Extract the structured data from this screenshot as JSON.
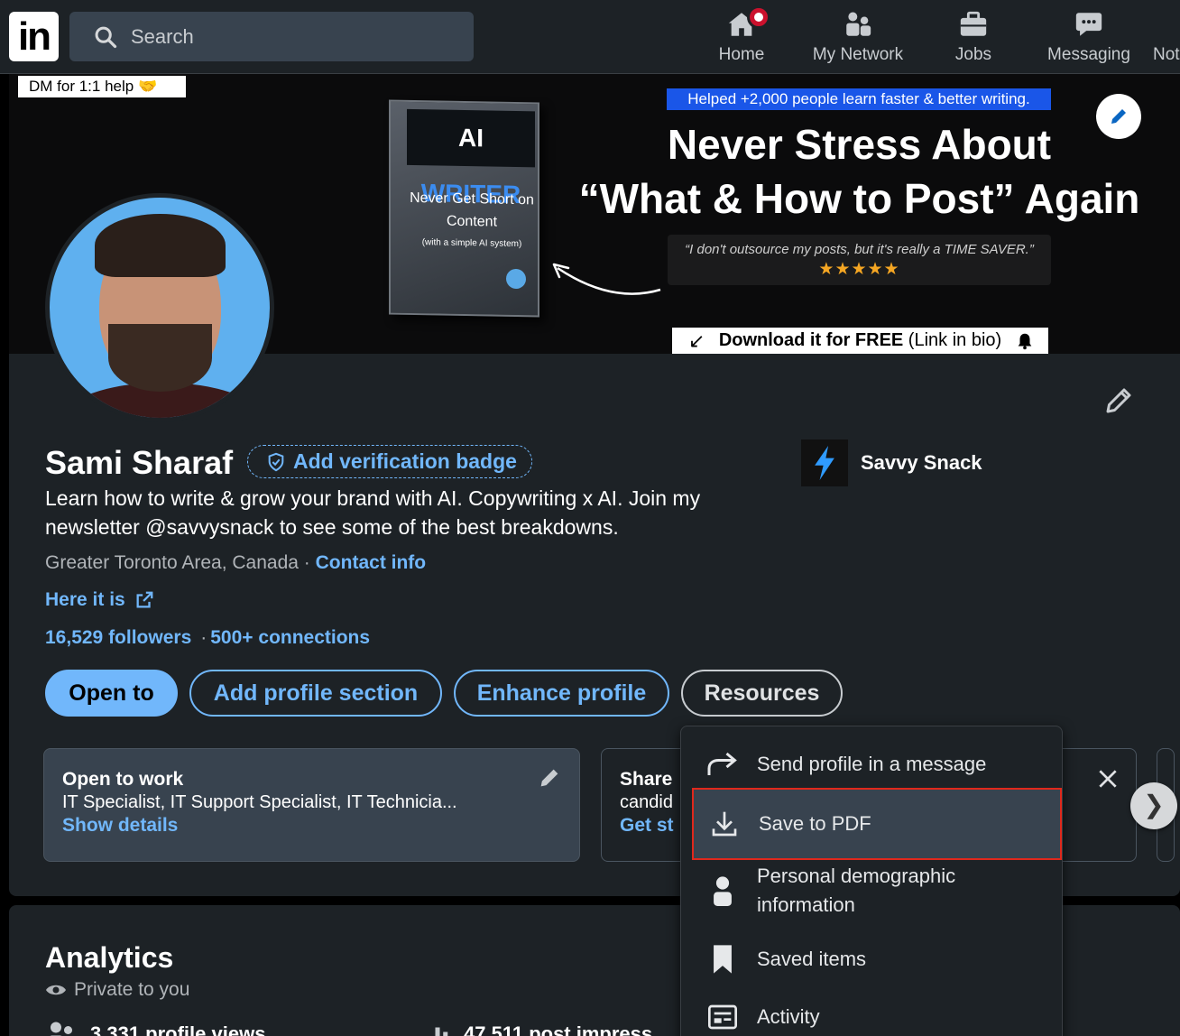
{
  "nav": {
    "search_placeholder": "Search",
    "items": [
      {
        "label": "Home"
      },
      {
        "label": "My Network"
      },
      {
        "label": "Jobs"
      },
      {
        "label": "Messaging"
      },
      {
        "label": "Not"
      }
    ]
  },
  "banner": {
    "dm_help": "DM for 1:1 help 🤝",
    "book_title_a": "AI ",
    "book_title_b": "WRITER",
    "book_subtitle": "Never Get Short on Content",
    "book_small": "(with a simple AI system)",
    "helped": "Helped +2,000 people learn faster & better writing.",
    "headline_line1": "Never Stress About",
    "headline_line2": "“What & How to Post” Again",
    "quote": "“I don't outsource my posts, but it's really a TIME SAVER.”",
    "stars": "★★★★★",
    "download_bold": "Download it for FREE",
    "download_rest": " (Link in bio)"
  },
  "profile": {
    "name": "Sami Sharaf",
    "verify_label": "Add verification badge",
    "company": "Savvy Snack",
    "bio": "Learn how to write & grow your brand with AI. Copywriting x AI. Join my newsletter @savvysnack to see some of the best breakdowns.",
    "location": "Greater Toronto Area, Canada",
    "contact_info": "Contact info",
    "link_label": "Here it is",
    "followers": "16,529 followers",
    "connections": "500+ connections"
  },
  "actions": {
    "open_to": "Open to",
    "add_section": "Add profile section",
    "enhance": "Enhance profile",
    "resources": "Resources"
  },
  "open_to_work": {
    "title": "Open to work",
    "roles": "IT Specialist, IT Support Specialist, IT Technicia...",
    "link": "Show details"
  },
  "share_card": {
    "title": "Share",
    "text": "candid",
    "link": "Get st"
  },
  "analytics": {
    "title": "Analytics",
    "privacy": "Private to you",
    "stat1": "3,331 profile views",
    "stat2": "47,511 post impress"
  },
  "resources_menu": {
    "items": [
      {
        "label": "Send profile in a message",
        "icon": "share-arrow-icon"
      },
      {
        "label": "Save to PDF",
        "icon": "download-icon",
        "selected": true
      },
      {
        "label": "Personal demographic information",
        "icon": "person-icon"
      },
      {
        "label": "Saved items",
        "icon": "bookmark-icon"
      },
      {
        "label": "Activity",
        "icon": "activity-icon"
      }
    ]
  },
  "colors": {
    "accent": "#71b7fb",
    "nav_bg": "#1d2226",
    "highlight": "#e0281c"
  }
}
